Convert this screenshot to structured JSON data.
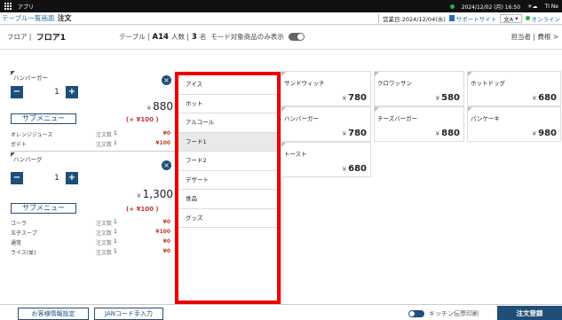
{
  "topbar": {
    "app_name": "アプリ",
    "datetime": "2024/12/02 (月) 16:50",
    "weather_icon": "sun-cloud-icon",
    "logo_text": "TI Ne"
  },
  "header": {
    "back_label": "テーブル一覧画面",
    "title": "注文",
    "business_day": "営業日:2024/12/04(水)",
    "support_label": "サポートサイト",
    "lang_label": "文A",
    "online_label": "オンライン"
  },
  "floorbar": {
    "floor_label": "フロア",
    "floor_value": "フロア1",
    "table_label": "テーブル",
    "table_value": "A14",
    "people_label": "人数",
    "people_value": "3",
    "people_unit": "名",
    "mode_label": "モード対象商品のみ表示",
    "staff_label": "担当者 | 費根 >"
  },
  "orders": [
    {
      "name": "ハンバーガー",
      "qty": "1",
      "price": "880",
      "currency": "¥",
      "submenu_label": "サブメニュー",
      "submenu_price": "(+ ¥100 )",
      "options": [
        {
          "name": "オレンジジュース",
          "qty_label": "注文数",
          "qty": "1",
          "price": "¥0"
        },
        {
          "name": "ポテト",
          "qty_label": "注文数",
          "qty": "1",
          "price": "¥100"
        }
      ]
    },
    {
      "name": "ハンバーグ",
      "qty": "1",
      "price": "1,300",
      "currency": "¥",
      "submenu_label": "サブメニュー",
      "submenu_price": "(+ ¥100 )",
      "options": [
        {
          "name": "コーラ",
          "qty_label": "注文数",
          "qty": "1",
          "price": "¥0"
        },
        {
          "name": "玉子スープ",
          "qty_label": "注文数",
          "qty": "1",
          "price": "¥100"
        },
        {
          "name": "通常",
          "qty_label": "注文数",
          "qty": "1",
          "price": "¥0"
        },
        {
          "name": "ライス(並)",
          "qty_label": "注文数",
          "qty": "1",
          "price": "¥0"
        }
      ]
    }
  ],
  "categories": [
    {
      "label": "アイス"
    },
    {
      "label": "ホット"
    },
    {
      "label": "アルコール"
    },
    {
      "label": "フード1"
    },
    {
      "label": "フード2"
    },
    {
      "label": "デザート"
    },
    {
      "label": "食品"
    },
    {
      "label": "グッズ"
    }
  ],
  "selected_category": "フード1",
  "products": [
    {
      "name": "サンドウィッチ",
      "price": "780",
      "currency": "¥"
    },
    {
      "name": "クロワッサン",
      "price": "580",
      "currency": "¥"
    },
    {
      "name": "ホットドッグ",
      "price": "680",
      "currency": "¥"
    },
    {
      "name": "ハンバーガー",
      "price": "780",
      "currency": "¥"
    },
    {
      "name": "チーズバーガー",
      "price": "880",
      "currency": "¥"
    },
    {
      "name": "パンケーキ",
      "price": "980",
      "currency": "¥"
    },
    {
      "name": "トースト",
      "price": "680",
      "currency": "¥"
    }
  ],
  "bottombar": {
    "customer_info_label": "お客様情報設定",
    "jan_label": "JANコード手入力",
    "kitchen_print_label": "キッチン伝票印刷",
    "register_label": "注文登録"
  },
  "colors": {
    "accent": "#1f4e79",
    "highlight_border": "#ee0000",
    "online_dot": "#2eaa48",
    "price_red": "#c0392b"
  }
}
